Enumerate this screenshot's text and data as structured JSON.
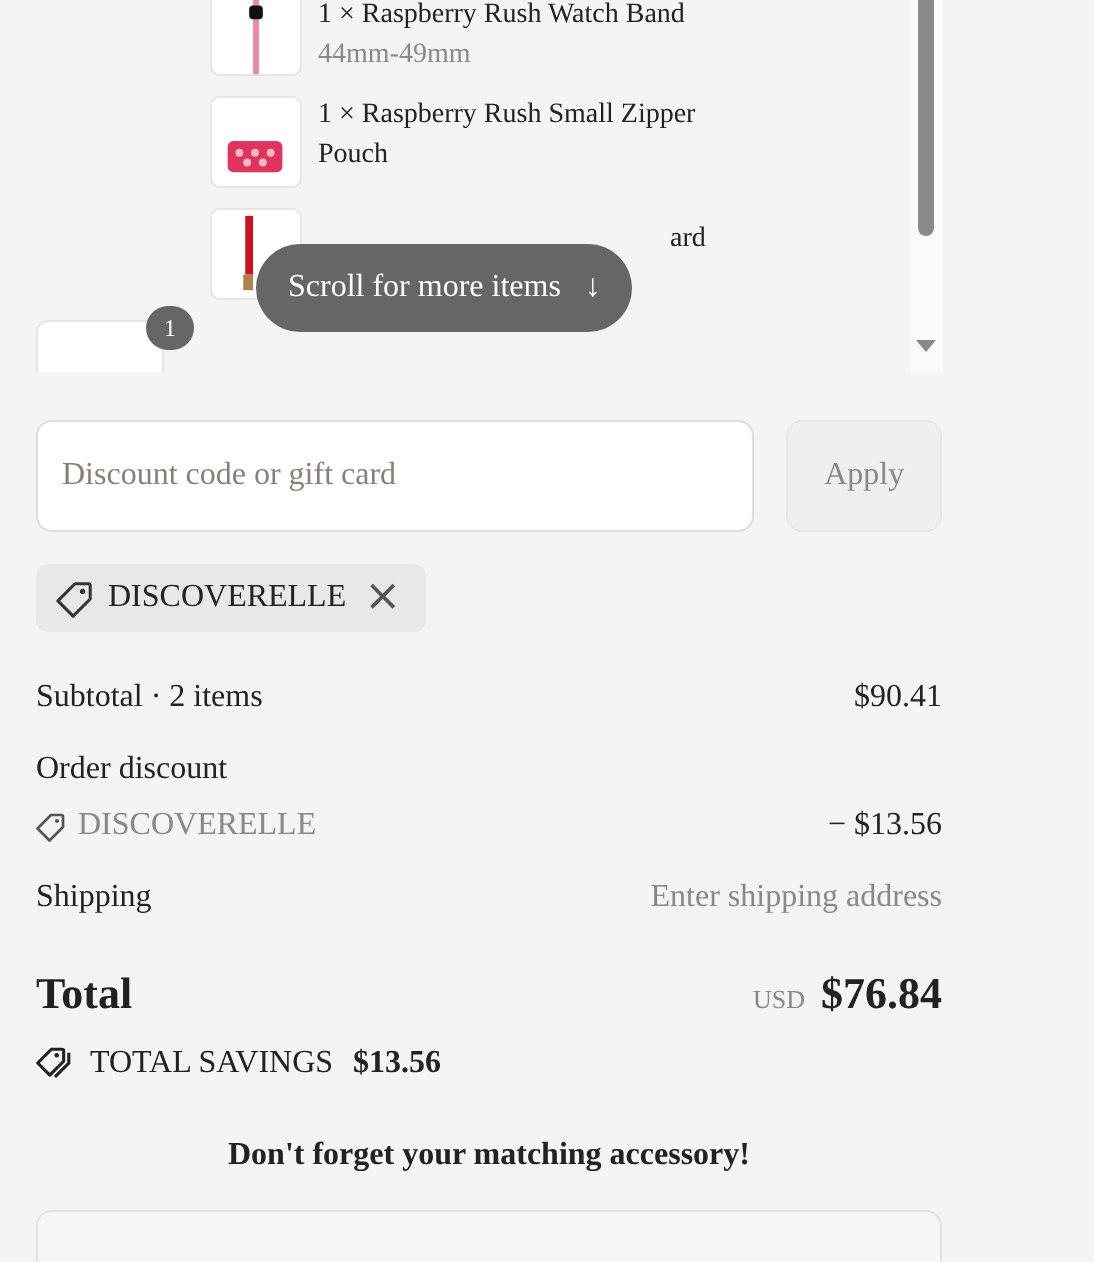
{
  "items": [
    {
      "kind": "band",
      "title": "1 × Raspberry Rush Watch Band",
      "variant": "44mm-49mm"
    },
    {
      "kind": "pouch",
      "title": "1 × Raspberry Rush Small Zipper Pouch"
    },
    {
      "kind": "lanyard",
      "title": "ard"
    }
  ],
  "protection_item": {
    "quantity": "1"
  },
  "scroll_hint": {
    "label": "Scroll for more items",
    "arrow": "↓"
  },
  "discount": {
    "placeholder": "Discount code or gift card",
    "apply": "Apply"
  },
  "applied_code": {
    "code": "DISCOVERELLE",
    "remove": "×"
  },
  "summary": [
    {
      "kind": "line",
      "label": "Subtotal · 2 items",
      "value": "$90.41"
    },
    {
      "kind": "heading",
      "label": "Order discount"
    },
    {
      "kind": "code",
      "label": "DISCOVERELLE",
      "value": "− $13.56"
    },
    {
      "kind": "muted",
      "label": "Shipping",
      "value": "Enter shipping address"
    }
  ],
  "total": {
    "label": "Total",
    "currency": "USD",
    "value": "$76.84"
  },
  "savings": {
    "label": "TOTAL SAVINGS",
    "value": "$13.56"
  },
  "upsell": {
    "title": "Don't forget your matching accessory!"
  }
}
